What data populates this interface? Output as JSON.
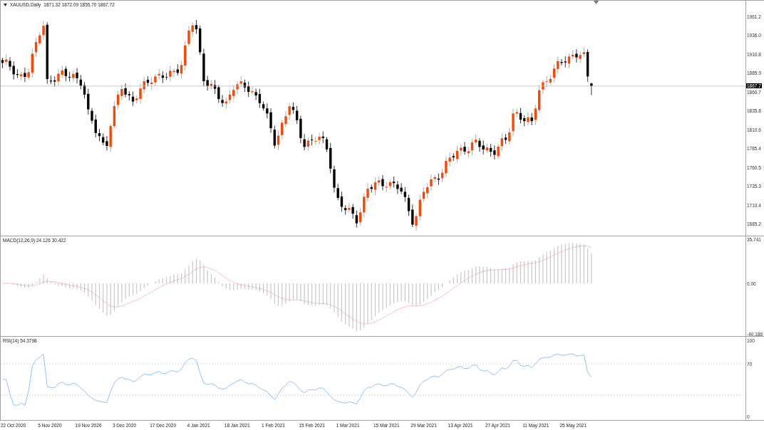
{
  "main_chart": {
    "symbol": "XAUUSD,Daily",
    "ohlc": "1871.32 1872.09 1855.70 1867.72",
    "price_ticks": [
      "1961.2",
      "1936.0",
      "1910.8",
      "1885.9",
      "1860.7",
      "1835.8",
      "1810.6",
      "1785.4",
      "1760.5",
      "1735.3",
      "1710.4",
      "1685.2"
    ],
    "current_price": "1867.7"
  },
  "macd": {
    "label": "MACD(12,26,9) 24.126 30.422",
    "ticks": [
      "35.741",
      "0.00",
      "-40.186"
    ]
  },
  "rsi": {
    "label": "RSI(14) 54.3798",
    "ticks": [
      "100",
      "70",
      "0"
    ]
  },
  "dates": [
    "22 Oct 2020",
    "5 Nov 2020",
    "19 Nov 2020",
    "3 Dec 2020",
    "17 Dec 2020",
    "4 Jan 2021",
    "18 Jan 2021",
    "1 Feb 2021",
    "15 Feb 2021",
    "1 Mar 2021",
    "15 Mar 2021",
    "29 Mar 2021",
    "13 Apr 2021",
    "27 Apr 2021",
    "11 May 2021",
    "25 May 2021"
  ]
}
